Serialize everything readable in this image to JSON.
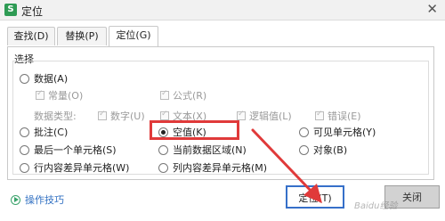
{
  "window": {
    "title": "定位",
    "app_icon_letter": "S",
    "close_glyph": "✕"
  },
  "tabs": [
    {
      "label": "查找(D)",
      "active": false
    },
    {
      "label": "替换(P)",
      "active": false
    },
    {
      "label": "定位(G)",
      "active": true
    }
  ],
  "section": {
    "label": "选择"
  },
  "options": {
    "data": {
      "label": "数据(A)",
      "selected": false
    },
    "constants": {
      "label": "常量(O)"
    },
    "formulas": {
      "label": "公式(R)"
    },
    "datatype_label": "数据类型:",
    "number": {
      "label": "数字(U)"
    },
    "text": {
      "label": "文本(X)"
    },
    "logical": {
      "label": "逻辑值(L)"
    },
    "errors": {
      "label": "错误(E)"
    },
    "comments": {
      "label": "批注(C)",
      "selected": false
    },
    "blanks": {
      "label": "空值(K)",
      "selected": true
    },
    "visible_cells": {
      "label": "可见单元格(Y)",
      "selected": false
    },
    "last_cell": {
      "label": "最后一个单元格(S)",
      "selected": false
    },
    "current_region": {
      "label": "当前数据区域(N)",
      "selected": false
    },
    "objects": {
      "label": "对象(B)",
      "selected": false
    },
    "row_diff": {
      "label": "行内容差异单元格(W)",
      "selected": false
    },
    "col_diff": {
      "label": "列内容差异单元格(M)",
      "selected": false
    }
  },
  "footer": {
    "tips_label": "操作技巧",
    "ok_label": "定位(T)",
    "cancel_label": "关闭"
  },
  "watermark": "Baidu经验",
  "colors": {
    "highlight": "#e03a3a",
    "primary_border": "#3670c9",
    "link": "#3170c2"
  }
}
